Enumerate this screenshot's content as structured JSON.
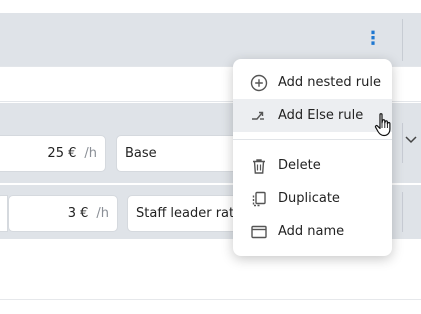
{
  "menu": {
    "items": [
      {
        "label": "Add nested rule",
        "icon": "plus-circle-icon"
      },
      {
        "label": "Add Else rule",
        "icon": "branch-arrow-icon"
      },
      {
        "label": "Delete",
        "icon": "trash-icon"
      },
      {
        "label": "Duplicate",
        "icon": "duplicate-icon"
      },
      {
        "label": "Add name",
        "icon": "name-box-icon"
      }
    ],
    "highlighted_index": 1
  },
  "rules": [
    {
      "rate_value": "25 €",
      "rate_unit": "/h",
      "name": "Base"
    },
    {
      "rate_value": "3 €",
      "rate_unit": "/h",
      "name": "Staff leader rate"
    }
  ],
  "colors": {
    "band": "#dfe3e8",
    "kebab_accent": "#1f78d1",
    "menu_highlight": "#eceef1"
  }
}
